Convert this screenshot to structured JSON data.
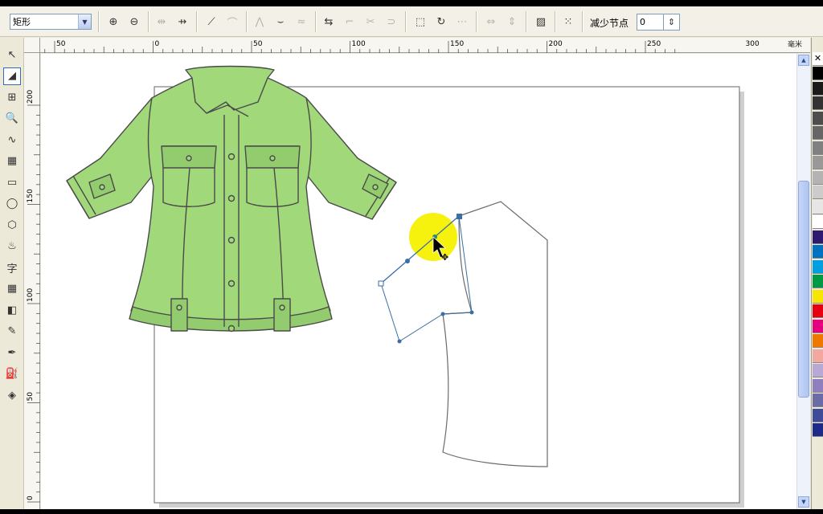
{
  "propbar": {
    "shape_type": "矩形",
    "reduce_nodes_label": "减少节点",
    "reduce_nodes_value": "0"
  },
  "ruler": {
    "corner_label": "",
    "unit": "毫米",
    "top_ticks": [
      {
        "label": "50"
      },
      {
        "label": "0"
      },
      {
        "label": "50"
      },
      {
        "label": "100"
      },
      {
        "label": "150"
      },
      {
        "label": "200"
      },
      {
        "label": "250"
      },
      {
        "label": "300"
      }
    ],
    "left_ticks": [
      {
        "label": "200"
      },
      {
        "label": "150"
      },
      {
        "label": "100"
      },
      {
        "label": "50"
      },
      {
        "label": "0"
      }
    ]
  },
  "toolbox": [
    {
      "name": "pick-tool",
      "icon": "arrow-icon",
      "glyph": "↖",
      "selected": false
    },
    {
      "name": "shape-tool",
      "icon": "shape-node-icon",
      "glyph": "◢",
      "selected": true
    },
    {
      "name": "crop-tool",
      "icon": "crop-icon",
      "glyph": "⊞",
      "selected": false
    },
    {
      "name": "zoom-tool",
      "icon": "zoom-icon",
      "glyph": "🔍",
      "selected": false
    },
    {
      "name": "freehand-tool",
      "icon": "freehand-icon",
      "glyph": "∿",
      "selected": false
    },
    {
      "name": "smart-fill-tool",
      "icon": "smart-fill-icon",
      "glyph": "▦",
      "selected": false
    },
    {
      "name": "rectangle-tool",
      "icon": "rectangle-icon",
      "glyph": "▭",
      "selected": false
    },
    {
      "name": "ellipse-tool",
      "icon": "ellipse-icon",
      "glyph": "◯",
      "selected": false
    },
    {
      "name": "polygon-tool",
      "icon": "polygon-icon",
      "glyph": "⬡",
      "selected": false
    },
    {
      "name": "basic-shapes-tool",
      "icon": "basic-shapes-icon",
      "glyph": "♨",
      "selected": false
    },
    {
      "name": "text-tool",
      "icon": "text-icon",
      "glyph": "字",
      "selected": false
    },
    {
      "name": "table-tool",
      "icon": "table-icon",
      "glyph": "▦",
      "selected": false
    },
    {
      "name": "interactive-tool",
      "icon": "blend-icon",
      "glyph": "◧",
      "selected": false
    },
    {
      "name": "eyedropper-tool",
      "icon": "eyedropper-icon",
      "glyph": "✎",
      "selected": false
    },
    {
      "name": "outline-tool",
      "icon": "pen-nib-icon",
      "glyph": "✒",
      "selected": false
    },
    {
      "name": "fill-tool",
      "icon": "paint-bucket-icon",
      "glyph": "⛽",
      "selected": false
    },
    {
      "name": "interactive-fill-tool",
      "icon": "interactive-fill-icon",
      "glyph": "◈",
      "selected": false
    }
  ],
  "colors": {
    "shirt_fill": "#a1d87a",
    "shirt_stroke": "#4a4a4a",
    "cursor_highlight": "#f5f000",
    "node_blue": "#3a6ea5",
    "page_shadow": "#cfcfcf"
  },
  "palette": [
    "#000000",
    "#1a1a1a",
    "#333333",
    "#4d4d4d",
    "#666666",
    "#808080",
    "#999999",
    "#b3b3b3",
    "#cccccc",
    "#e6e6e6",
    "#ffffff",
    "#2e1a6e",
    "#0070c0",
    "#00a0e0",
    "#009a44",
    "#f7e600",
    "#e60012",
    "#e4007f",
    "#ee7800",
    "#f4a6a0",
    "#b9a7d6",
    "#8f7fbf",
    "#6b6ba8",
    "#3e4c9a",
    "#1d2a8a"
  ]
}
